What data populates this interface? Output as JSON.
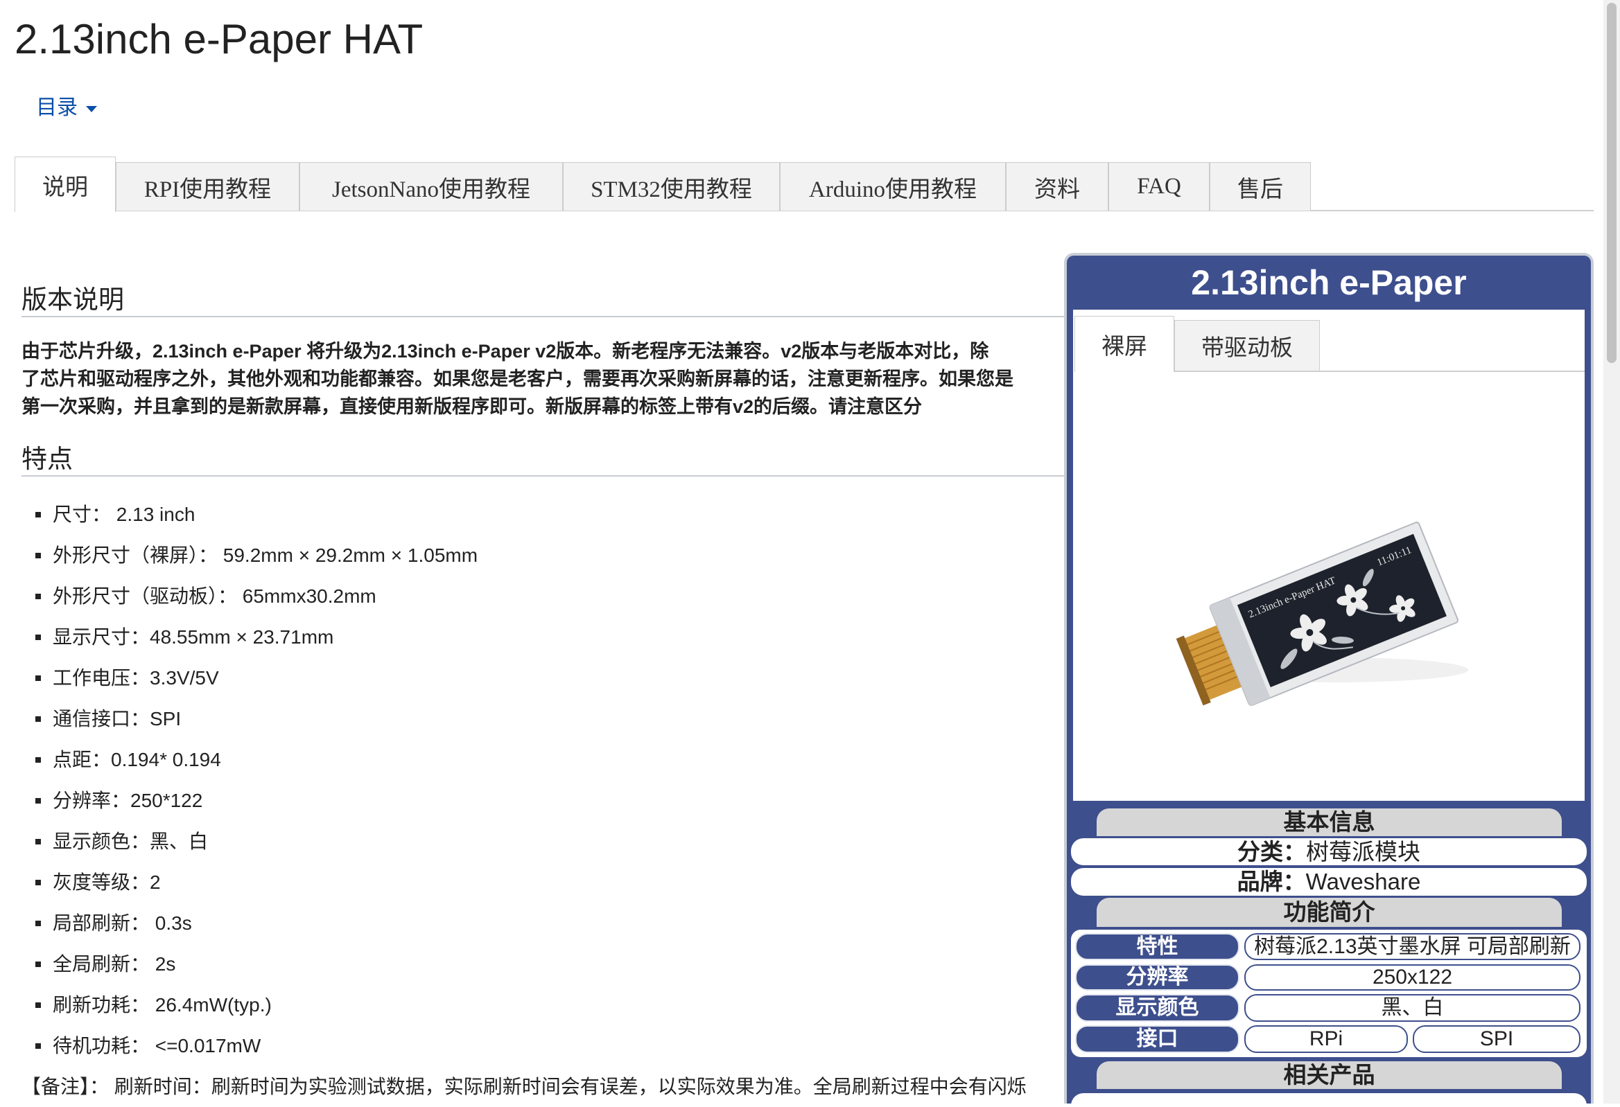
{
  "colors": {
    "accent": "#3e4f8d",
    "link": "#0b4fa8",
    "bar": "#d6d6d6",
    "tab_inactive": "#f2f2f2"
  },
  "page": {
    "title": "2.13inch e-Paper HAT",
    "toc_label": "目录",
    "toc_icon": "chevron-down-icon"
  },
  "tabs": [
    {
      "label": "说明",
      "active": true
    },
    {
      "label": "RPI使用教程",
      "active": false
    },
    {
      "label": "JetsonNano使用教程",
      "active": false
    },
    {
      "label": "STM32使用教程",
      "active": false
    },
    {
      "label": "Arduino使用教程",
      "active": false
    },
    {
      "label": "资料",
      "active": false
    },
    {
      "label": "FAQ",
      "active": false
    },
    {
      "label": "售后",
      "active": false
    }
  ],
  "content": {
    "version_heading": "版本说明",
    "version_lines": [
      "由于芯片升级，2.13inch e-Paper 将升级为2.13inch e-Paper v2版本。新老程序无法兼容。v2版本与老版本对比，除",
      "了芯片和驱动程序之外，其他外观和功能都兼容。如果您是老客户，需要再次采购新屏幕的话，注意更新程序。如果您是",
      "第一次采购，并且拿到的是新款屏幕，直接使用新版程序即可。新版屏幕的标签上带有v2的后缀。请注意区分"
    ],
    "features_heading": "特点",
    "features": [
      "尺寸： 2.13 inch",
      "外形尺寸（裸屏）： 59.2mm × 29.2mm × 1.05mm",
      "外形尺寸（驱动板）： 65mmx30.2mm",
      "显示尺寸：48.55mm × 23.71mm",
      "工作电压：3.3V/5V",
      "通信接口：SPI",
      "点距：0.194* 0.194",
      "分辨率：250*122",
      "显示颜色：黑、白",
      "灰度等级：2",
      "局部刷新： 0.3s",
      "全局刷新： 2s",
      "刷新功耗： 26.4mW(typ.)",
      "待机功耗： <=0.017mW"
    ],
    "note": "【备注】： 刷新时间：刷新时间为实验测试数据，实际刷新时间会有误差，以实际效果为准。全局刷新过程中会有闪烁"
  },
  "infobox": {
    "title": "2.13inch e-Paper",
    "tabs": [
      {
        "label": "裸屏",
        "active": true
      },
      {
        "label": "带驱动板",
        "active": false
      }
    ],
    "image": {
      "screen_title": "2.13inch e-Paper HAT",
      "screen_clock": "11:01:11"
    },
    "basic_heading": "基本信息",
    "basic": [
      {
        "label": "分类：",
        "value": "树莓派模块"
      },
      {
        "label": "品牌：",
        "value": "Waveshare"
      }
    ],
    "feature_heading": "功能简介",
    "specs": [
      {
        "label": "特性",
        "value": "树莓派2.13英寸墨水屏 可局部刷新"
      },
      {
        "label": "分辨率",
        "value": "250x122"
      },
      {
        "label": "显示颜色",
        "value": "黑、白"
      },
      {
        "label": "接口",
        "values": [
          "RPi",
          "SPI"
        ]
      }
    ],
    "related_heading": "相关产品"
  }
}
